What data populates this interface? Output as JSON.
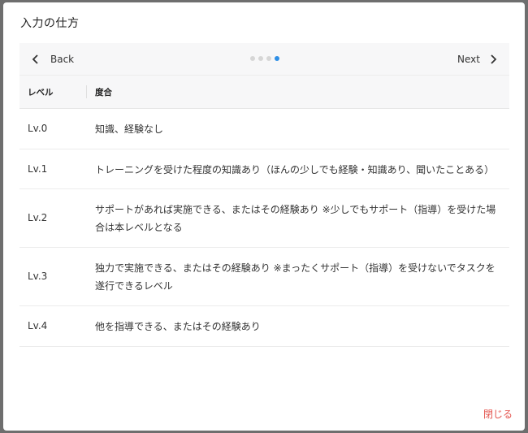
{
  "modal": {
    "title": "入力の仕方",
    "close_label": "閉じる"
  },
  "pager": {
    "back_label": "Back",
    "next_label": "Next",
    "total_pages": 4,
    "current_page": 4
  },
  "table": {
    "headers": [
      "レベル",
      "度合"
    ],
    "rows": [
      {
        "level": "Lv.0",
        "description": "知識、経験なし"
      },
      {
        "level": "Lv.1",
        "description": "トレーニングを受けた程度の知識あり（ほんの少しでも経験・知識あり、聞いたことある）"
      },
      {
        "level": "Lv.2",
        "description": "サポートがあれば実施できる、またはその経験あり ※少しでもサポート（指導）を受けた場合は本レベルとなる"
      },
      {
        "level": "Lv.3",
        "description": "独力で実施できる、またはその経験あり ※まったくサポート（指導）を受けないでタスクを遂行できるレベル"
      },
      {
        "level": "Lv.4",
        "description": "他を指導できる、またはその経験あり"
      }
    ]
  },
  "colors": {
    "accent": "#2f8fe6",
    "close": "#e4554f"
  }
}
